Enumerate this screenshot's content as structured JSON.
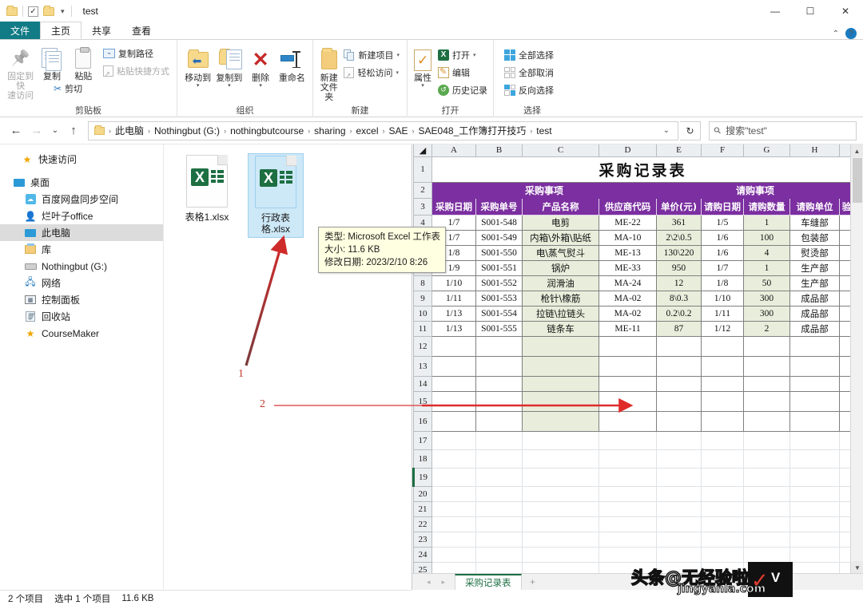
{
  "window": {
    "title": "test",
    "minimize": "—",
    "maximize": "☐",
    "close": "✕"
  },
  "quick_access": {
    "caret": "▾"
  },
  "tabs": [
    {
      "label": "文件",
      "id": "file"
    },
    {
      "label": "主页",
      "id": "home"
    },
    {
      "label": "共享",
      "id": "share"
    },
    {
      "label": "查看",
      "id": "view"
    }
  ],
  "ribbon": {
    "help": "?",
    "collapse": "⌃",
    "groups": [
      {
        "name": "剪贴板",
        "big": [
          {
            "label1": "固定到快",
            "label2": "速访问",
            "icon": "pin-icon",
            "dim": true
          },
          {
            "label1": "复制",
            "label2": "",
            "icon": "copy-icon",
            "dim": false
          },
          {
            "label1": "粘贴",
            "label2": "",
            "icon": "paste-icon",
            "dim": false
          }
        ],
        "small": [
          {
            "label": "复制路径",
            "icon": "copy-path-icon",
            "caret": "",
            "dim": false
          },
          {
            "label": "粘贴快捷方式",
            "icon": "paste-shortcut-icon",
            "caret": "",
            "dim": true
          },
          {
            "label": "剪切",
            "icon": "scissors-icon",
            "caret": "",
            "dim": false
          }
        ]
      },
      {
        "name": "组织",
        "big": [
          {
            "label1": "移动到",
            "label2": "",
            "icon": "move-to-icon",
            "caret": "▾"
          },
          {
            "label1": "复制到",
            "label2": "",
            "icon": "copy-to-icon",
            "caret": "▾"
          },
          {
            "label1": "删除",
            "label2": "",
            "icon": "delete-icon",
            "caret": "▾"
          },
          {
            "label1": "重命名",
            "label2": "",
            "icon": "rename-icon",
            "caret": ""
          }
        ]
      },
      {
        "name": "新建",
        "big": [
          {
            "label1": "新建",
            "label2": "文件夹",
            "icon": "new-folder-icon",
            "caret": ""
          }
        ],
        "small": [
          {
            "label": "新建项目",
            "icon": "new-item-icon",
            "caret": "▾"
          },
          {
            "label": "轻松访问",
            "icon": "easy-access-icon",
            "caret": "▾"
          }
        ]
      },
      {
        "name": "打开",
        "big": [
          {
            "label1": "属性",
            "label2": "",
            "icon": "properties-icon",
            "caret": "▾"
          }
        ],
        "small": [
          {
            "label": "打开",
            "icon": "excel-open-icon",
            "caret": "▾"
          },
          {
            "label": "编辑",
            "icon": "edit-icon",
            "caret": ""
          },
          {
            "label": "历史记录",
            "icon": "history-icon",
            "caret": ""
          }
        ]
      },
      {
        "name": "选择",
        "small": [
          {
            "label": "全部选择",
            "icon": "select-all-icon",
            "caret": ""
          },
          {
            "label": "全部取消",
            "icon": "select-none-icon",
            "caret": ""
          },
          {
            "label": "反向选择",
            "icon": "invert-selection-icon",
            "caret": ""
          }
        ]
      }
    ]
  },
  "address": {
    "back": "←",
    "forward": "→",
    "recent": "⌄",
    "up": "↑",
    "breadcrumbs": [
      "此电脑",
      "Nothingbut (G:)",
      "nothingbutcourse",
      "sharing",
      "excel",
      "SAE",
      "SAE048_工作簿打开技巧",
      "test"
    ],
    "separator": "›",
    "dropdown": "⌄",
    "refresh": "↻"
  },
  "search": {
    "placeholder": "搜索\"test\"",
    "value": "搜索\"test\""
  },
  "nav_pane": {
    "items": [
      {
        "label": "快速访问",
        "icon": "star-icon",
        "indent": 0,
        "selected": false
      },
      {
        "label": "桌面",
        "icon": "desktop-icon",
        "indent": 0,
        "selected": false
      },
      {
        "label": "百度网盘同步空间",
        "icon": "baidu-cloud-icon",
        "indent": 1,
        "selected": false
      },
      {
        "label": "烂叶子office",
        "icon": "user-icon",
        "indent": 1,
        "selected": false
      },
      {
        "label": "此电脑",
        "icon": "this-pc-icon",
        "indent": 1,
        "selected": true
      },
      {
        "label": "库",
        "icon": "library-icon",
        "indent": 1,
        "selected": false
      },
      {
        "label": "Nothingbut (G:)",
        "icon": "drive-icon",
        "indent": 1,
        "selected": false
      },
      {
        "label": "网络",
        "icon": "network-icon",
        "indent": 1,
        "selected": false
      },
      {
        "label": "控制面板",
        "icon": "control-panel-icon",
        "indent": 1,
        "selected": false
      },
      {
        "label": "回收站",
        "icon": "recycle-bin-icon",
        "indent": 1,
        "selected": false
      },
      {
        "label": "CourseMaker",
        "icon": "star-icon",
        "indent": 1,
        "selected": false
      }
    ]
  },
  "files": [
    {
      "name": "表格1.xlsx",
      "selected": false
    },
    {
      "name": "行政表格.xlsx",
      "selected": true
    }
  ],
  "tooltip": {
    "line1": "类型: Microsoft Excel 工作表",
    "line2": "大小: 11.6 KB",
    "line3": "修改日期: 2023/2/10 8:26"
  },
  "annotations": [
    {
      "label": "1",
      "target": "selected-file"
    },
    {
      "label": "2",
      "target": "spreadsheet-row-14"
    }
  ],
  "statusbar": {
    "count": "2 个项目",
    "selection": "选中 1 个项目",
    "size": "11.6 KB"
  },
  "excel": {
    "column_headers": [
      "A",
      "B",
      "C",
      "D",
      "E",
      "F",
      "G",
      "H"
    ],
    "corner": "◢",
    "row_numbers": [
      "1",
      "2",
      "3",
      "4",
      "5",
      "6",
      "7",
      "8",
      "9",
      "10",
      "11",
      "12",
      "13",
      "14",
      "15",
      "16",
      "17",
      "18",
      "19",
      "20",
      "21",
      "22",
      "23",
      "24",
      "25"
    ],
    "title": "采购记录表",
    "group_headers": [
      {
        "label": "采购事项",
        "span": 4
      },
      {
        "label": "请购事项",
        "span": 4
      }
    ],
    "sub_headers": [
      "采购日期",
      "采购单号",
      "产品名称",
      "供应商代码",
      "单价(元)",
      "请购日期",
      "请购数量",
      "请购单位",
      "验"
    ],
    "rows": [
      [
        "1/7",
        "S001-548",
        "电剪",
        "ME-22",
        "361",
        "1/5",
        "1",
        "车缝部"
      ],
      [
        "1/7",
        "S001-549",
        "内箱\\外箱\\贴纸",
        "MA-10",
        "2\\2\\0.5",
        "1/6",
        "100",
        "包装部"
      ],
      [
        "1/8",
        "S001-550",
        "电\\蒸气熨斗",
        "ME-13",
        "130\\220",
        "1/6",
        "4",
        "熨烫部"
      ],
      [
        "1/9",
        "S001-551",
        "锅炉",
        "ME-33",
        "950",
        "1/7",
        "1",
        "生产部"
      ],
      [
        "1/10",
        "S001-552",
        "润滑油",
        "MA-24",
        "12",
        "1/8",
        "50",
        "生产部"
      ],
      [
        "1/11",
        "S001-553",
        "枪针\\橡筋",
        "MA-02",
        "8\\0.3",
        "1/10",
        "300",
        "成品部"
      ],
      [
        "1/13",
        "S001-554",
        "拉链\\拉链头",
        "MA-02",
        "0.2\\0.2",
        "1/11",
        "300",
        "成品部"
      ],
      [
        "1/13",
        "S001-555",
        "链条车",
        "ME-11",
        "87",
        "1/12",
        "2",
        "成品部"
      ]
    ],
    "sheet_tab": "采购记录表",
    "add_sheet": "+",
    "nav_prev": "◂",
    "nav_next": "▸",
    "scroll_up": "▲",
    "scroll_down": "▼"
  },
  "watermark": {
    "main": "头条@无经验啦",
    "sub": "jingyanla.com",
    "mark": "✓",
    "letter": "V"
  },
  "colors": {
    "file_tab": "#117b86",
    "header_purple": "#7b2fa0",
    "tint_green": "#e9eedc",
    "excel_green": "#1d6f42",
    "annotation_red": "#c0392b",
    "selection_blue": "#cde8f7"
  }
}
